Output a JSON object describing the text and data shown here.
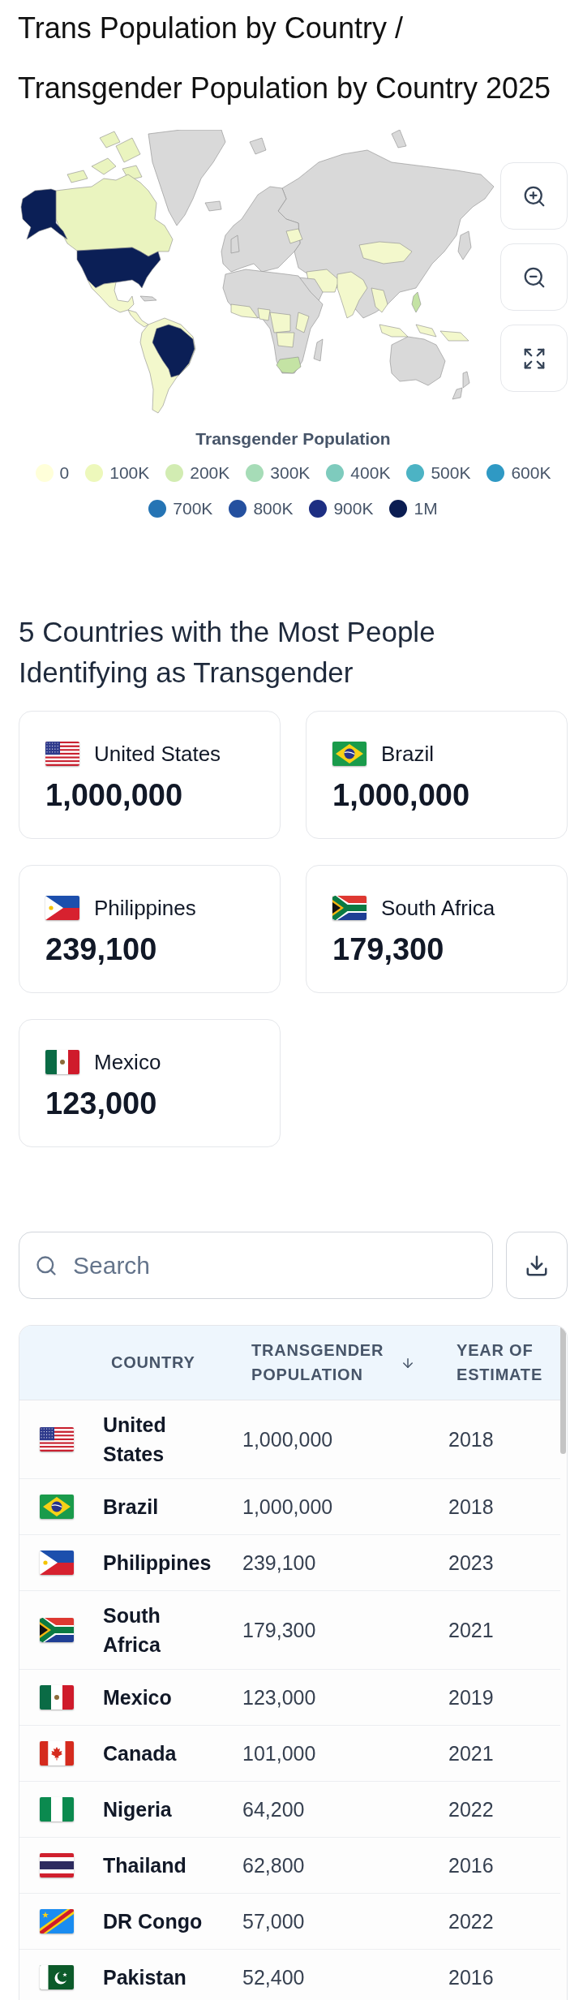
{
  "page_title": "Trans Population by Country / Transgender Population by Country 2025",
  "map": {
    "legend": {
      "title": "Transgender Population",
      "items": [
        {
          "label": "0",
          "color": "#ffffd9"
        },
        {
          "label": "100K",
          "color": "#edf8bb"
        },
        {
          "label": "200K",
          "color": "#d2ecb2"
        },
        {
          "label": "300K",
          "color": "#a6dcb7"
        },
        {
          "label": "400K",
          "color": "#7ecbbd"
        },
        {
          "label": "500K",
          "color": "#4cb3c4"
        },
        {
          "label": "600K",
          "color": "#2f99c4"
        },
        {
          "label": "700K",
          "color": "#2574b4"
        },
        {
          "label": "800K",
          "color": "#24509f"
        },
        {
          "label": "900K",
          "color": "#1d2e82"
        },
        {
          "label": "1M",
          "color": "#0b1d52"
        }
      ]
    }
  },
  "top_countries": {
    "title": "5 Countries with the Most People Identifying as Transgender",
    "cards": [
      {
        "kind": "us",
        "country": "United States",
        "population": "1,000,000"
      },
      {
        "kind": "br",
        "country": "Brazil",
        "population": "1,000,000"
      },
      {
        "kind": "ph",
        "country": "Philippines",
        "population": "239,100"
      },
      {
        "kind": "za",
        "country": "South Africa",
        "population": "179,300"
      },
      {
        "kind": "mx",
        "country": "Mexico",
        "population": "123,000"
      }
    ]
  },
  "table": {
    "search": {
      "placeholder": "Search"
    },
    "columns": [
      {
        "label": "COUNTRY",
        "sorted": false
      },
      {
        "label": "TRANSGENDER POPULATION",
        "sorted": true
      },
      {
        "label": "YEAR OF ESTIMATE",
        "sorted": false
      }
    ],
    "rows": [
      {
        "kind": "us",
        "country": "United States",
        "population": "1,000,000",
        "year": "2018"
      },
      {
        "kind": "br",
        "country": "Brazil",
        "population": "1,000,000",
        "year": "2018"
      },
      {
        "kind": "ph",
        "country": "Philippines",
        "population": "239,100",
        "year": "2023"
      },
      {
        "kind": "za",
        "country": "South Africa",
        "population": "179,300",
        "year": "2021"
      },
      {
        "kind": "mx",
        "country": "Mexico",
        "population": "123,000",
        "year": "2019"
      },
      {
        "kind": "ca",
        "country": "Canada",
        "population": "101,000",
        "year": "2021"
      },
      {
        "kind": "ng",
        "country": "Nigeria",
        "population": "64,200",
        "year": "2022"
      },
      {
        "kind": "th",
        "country": "Thailand",
        "population": "62,800",
        "year": "2016"
      },
      {
        "kind": "cd",
        "country": "DR Congo",
        "population": "57,000",
        "year": "2022"
      },
      {
        "kind": "pk",
        "country": "Pakistan",
        "population": "52,400",
        "year": "2016"
      }
    ]
  }
}
